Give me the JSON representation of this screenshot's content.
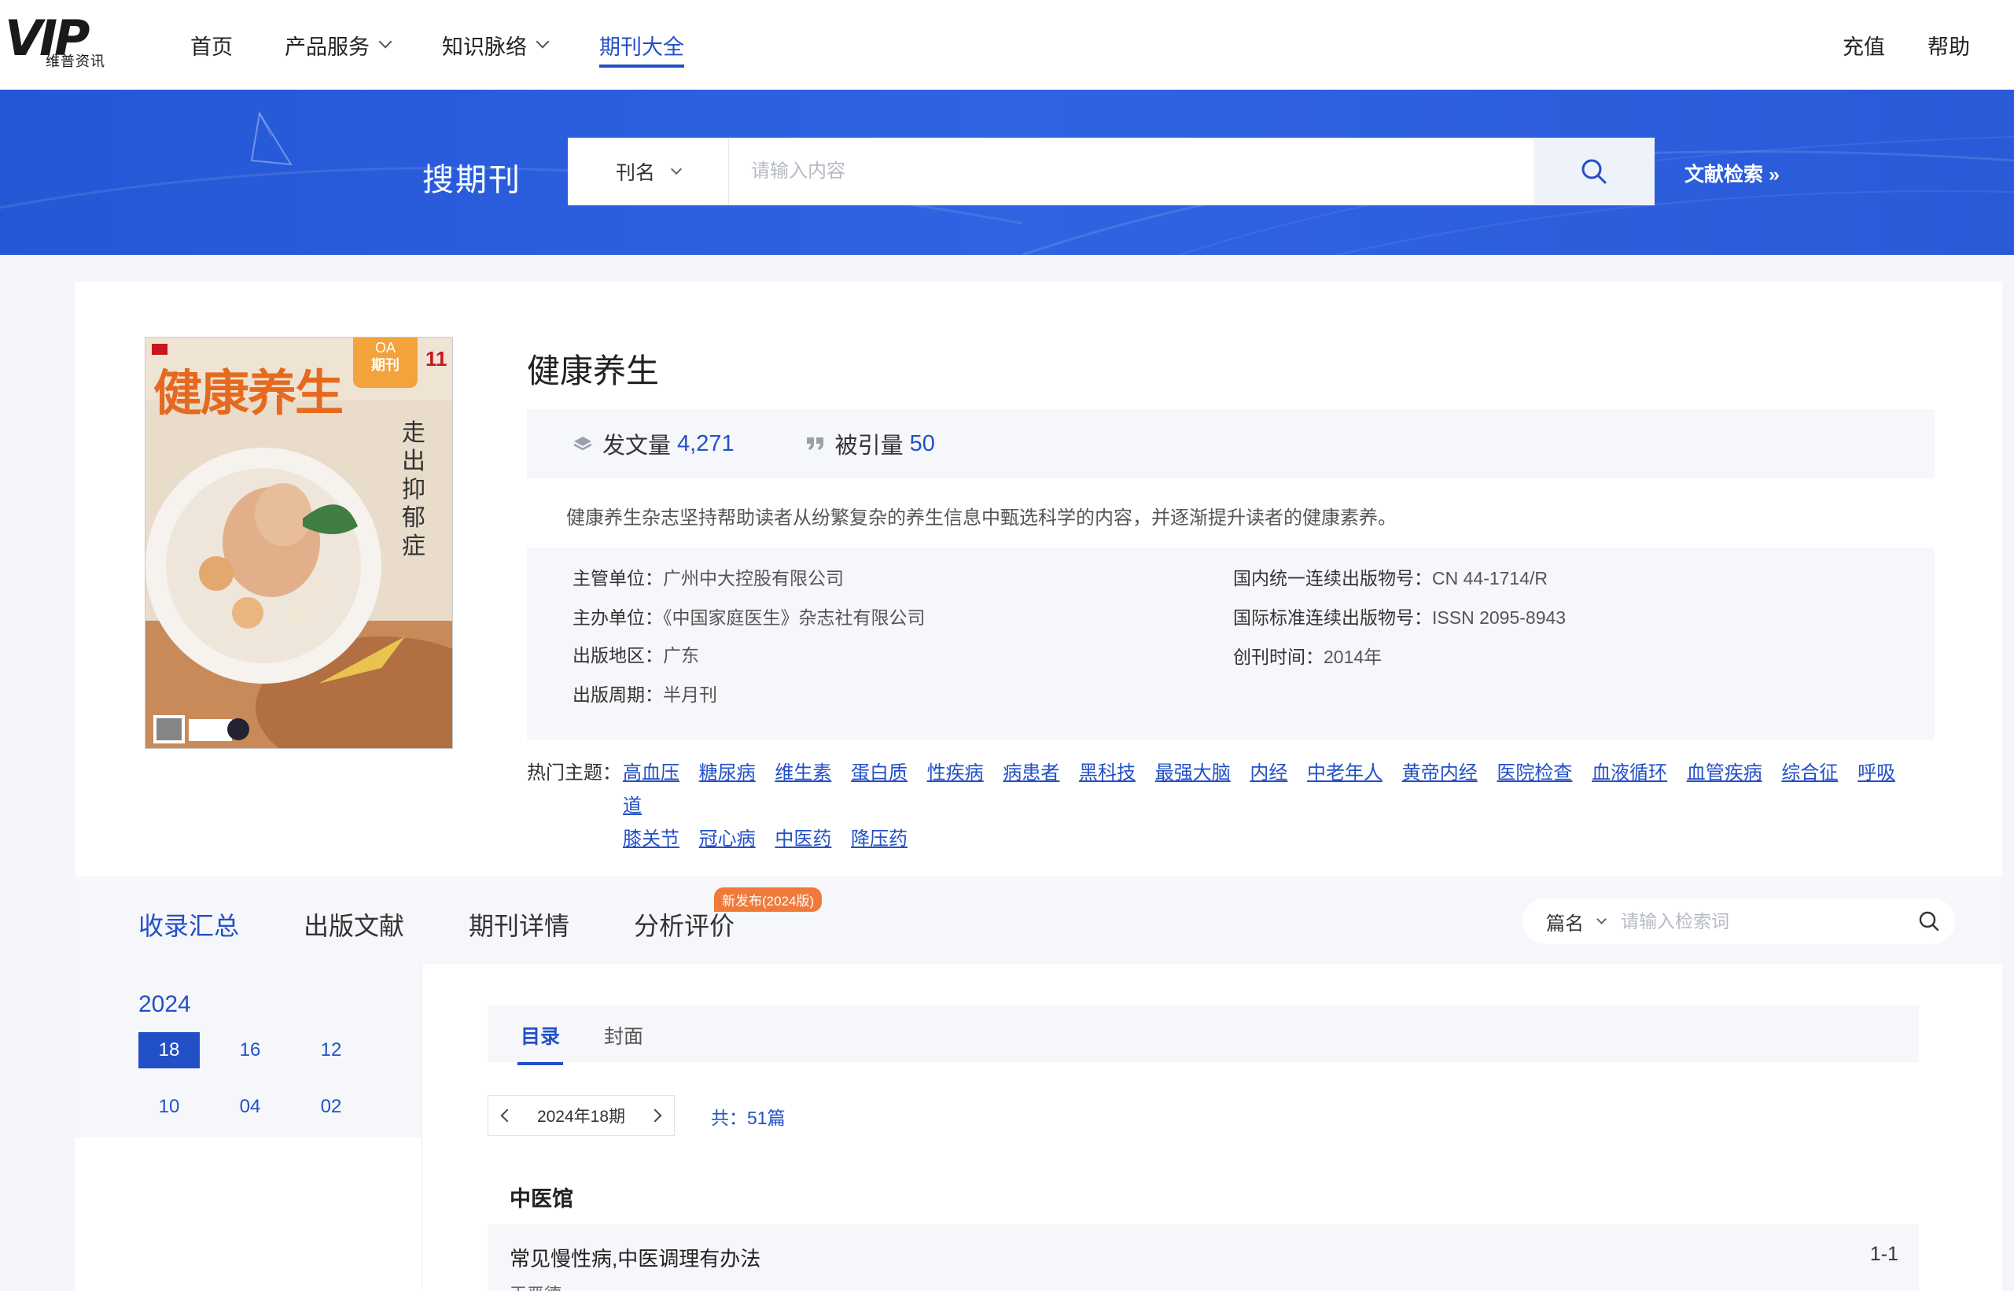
{
  "brand": {
    "logo_text": "VIP",
    "logo_sub": "维普资讯"
  },
  "nav": {
    "items": [
      {
        "label": "首页"
      },
      {
        "label": "产品服务"
      },
      {
        "label": "知识脉络"
      },
      {
        "label": "期刊大全"
      }
    ],
    "right": [
      {
        "label": "充值"
      },
      {
        "label": "帮助"
      }
    ]
  },
  "banner": {
    "title": "搜期刊",
    "search_type": "刊名",
    "search_placeholder": "请输入内容",
    "adv_link": "文献检索 »"
  },
  "journal": {
    "title": "健康养生",
    "cover": {
      "masthead": "健康养生",
      "oa_badge_top": "OA",
      "oa_badge_bottom": "期刊",
      "issue_no": "11",
      "headline": "走出抑郁症"
    },
    "stats": [
      {
        "label": "发文量",
        "value": "4,271",
        "icon": "layers-icon"
      },
      {
        "label": "被引量",
        "value": "50",
        "icon": "quote-icon"
      }
    ],
    "description": "健康养生杂志坚持帮助读者从纷繁复杂的养生信息中甄选科学的内容，并逐渐提升读者的健康素养。",
    "info": {
      "supervisor_k": "主管单位：",
      "supervisor_v": "广州中大控股有限公司",
      "sponsor_k": "主办单位：",
      "sponsor_v": "《中国家庭医生》杂志社有限公司",
      "region_k": "出版地区：",
      "region_v": "广东",
      "cycle_k": "出版周期：",
      "cycle_v": "半月刊",
      "cn_k": "国内统一连续出版物号：",
      "cn_v": "CN 44-1714/R",
      "issn_k": "国际标准连续出版物号：",
      "issn_v": "ISSN 2095-8943",
      "founded_k": "创刊时间：",
      "founded_v": "2014年"
    },
    "topics_label": "热门主题：",
    "topics": [
      "高血压",
      "糖尿病",
      "维生素",
      "蛋白质",
      "性疾病",
      "病患者",
      "黑科技",
      "最强大脑",
      "内经",
      "中老年人",
      "黄帝内经",
      "医院检查",
      "血液循环",
      "血管疾病",
      "综合征",
      "呼吸道",
      "膝关节",
      "冠心病",
      "中医药",
      "降压药"
    ]
  },
  "tabs": [
    {
      "label": "收录汇总"
    },
    {
      "label": "出版文献"
    },
    {
      "label": "期刊详情"
    },
    {
      "label": "分析评价"
    }
  ],
  "tab_badge": "新发布(2024版)",
  "inner_search": {
    "type": "篇名",
    "placeholder": "请输入检索词"
  },
  "years": {
    "year": "2024",
    "issues": [
      "18",
      "16",
      "12",
      "10",
      "04",
      "02"
    ]
  },
  "subtabs": [
    {
      "label": "目录"
    },
    {
      "label": "封面"
    }
  ],
  "issue_nav": {
    "label": "2024年18期",
    "count": "共：51篇"
  },
  "toc": {
    "section": "中医馆",
    "articles": [
      {
        "title": "常见慢性病,中医调理有办法",
        "pages": "1-1",
        "author": "王严德"
      }
    ]
  },
  "colors": {
    "accent": "#2250c7",
    "banner": "#2f63e2",
    "badge": "#f07a3a"
  }
}
